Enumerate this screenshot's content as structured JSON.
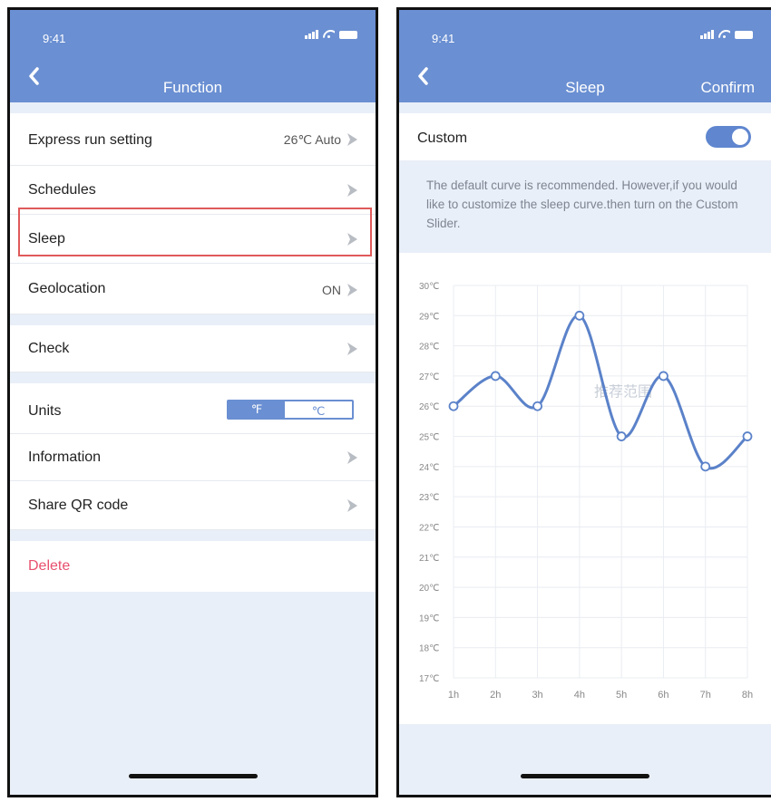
{
  "left": {
    "time": "9:41",
    "title": "Function",
    "rows": [
      {
        "label": "Express run setting",
        "value": "26℃ Auto"
      },
      {
        "label": "Schedules"
      },
      {
        "label": "Sleep"
      },
      {
        "label": "Geolocation",
        "value": "ON"
      },
      {
        "label": "Check"
      },
      {
        "label": "Units",
        "unit_f": "℉",
        "unit_c": "℃"
      },
      {
        "label": "Information"
      },
      {
        "label": "Share QR code"
      },
      {
        "label": "Delete"
      }
    ]
  },
  "right": {
    "time": "9:41",
    "title": "Sleep",
    "confirm": "Confirm",
    "custom_label": "Custom",
    "custom_on": true,
    "description": "The default curve is recommended. However,if you would like to customize the sleep curve.then turn on the Custom Slider."
  },
  "colors": {
    "accent": "#6a8fd2",
    "delete": "#e8506e",
    "highlight": "#e05a5a",
    "curve": "#5b82c9"
  },
  "chart_data": {
    "type": "line",
    "categories": [
      "1h",
      "2h",
      "3h",
      "4h",
      "5h",
      "6h",
      "7h",
      "8h"
    ],
    "y_ticks": [
      "30℃",
      "29℃",
      "28℃",
      "27℃",
      "26℃",
      "25℃",
      "24℃",
      "23℃",
      "22℃",
      "21℃",
      "20℃",
      "19℃",
      "18℃",
      "17℃"
    ],
    "values": [
      26,
      27,
      26,
      29,
      25,
      27,
      24,
      25
    ],
    "ylim": [
      17,
      30
    ],
    "grid": true,
    "watermark": "推荐范围"
  }
}
